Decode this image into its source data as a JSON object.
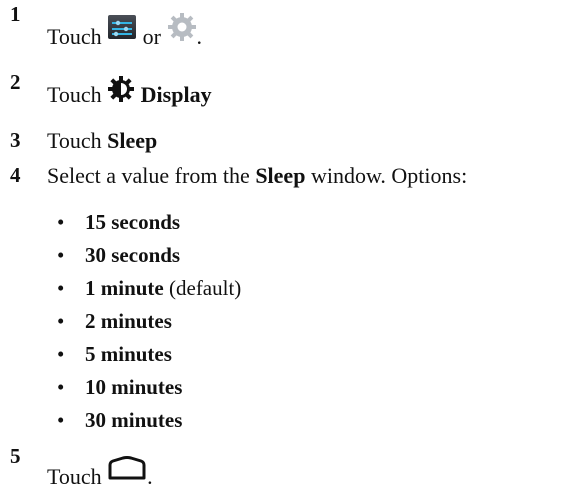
{
  "steps": [
    {
      "num": "1",
      "pre": "Touch",
      "mid": "or",
      "post": "."
    },
    {
      "num": "2",
      "pre": "Touch",
      "bold": "Display"
    },
    {
      "num": "3",
      "pre": "Touch",
      "bold": "Sleep"
    },
    {
      "num": "4",
      "pre": "Select a value from the",
      "bold": "Sleep",
      "post": "window. Options:"
    },
    {
      "num": "5",
      "pre": "Touch",
      "post": "."
    }
  ],
  "options": [
    {
      "label": "15 seconds",
      "note": ""
    },
    {
      "label": "30 seconds",
      "note": ""
    },
    {
      "label": "1 minute",
      "note": "(default)"
    },
    {
      "label": "2 minutes",
      "note": ""
    },
    {
      "label": "5 minutes",
      "note": ""
    },
    {
      "label": "10 minutes",
      "note": ""
    },
    {
      "label": "30 minutes",
      "note": ""
    }
  ],
  "bullet": "•",
  "icons": [
    "quick-settings-icon",
    "settings-gear-icon",
    "display-brightness-icon",
    "home-icon"
  ]
}
